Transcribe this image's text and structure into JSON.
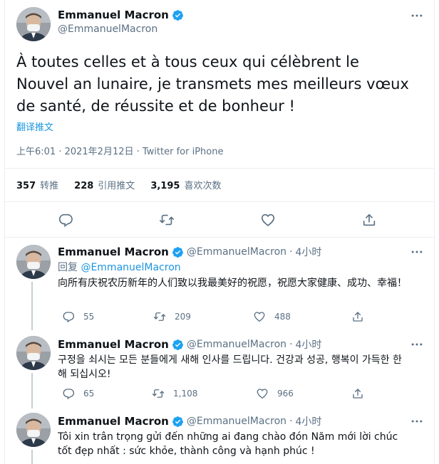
{
  "colors": {
    "accent": "#1da1f2",
    "link": "#1b95e0",
    "text": "#0f1419",
    "muted": "#5b7083"
  },
  "main_tweet": {
    "name": "Emmanuel Macron",
    "handle": "@EmmanuelMacron",
    "text": "À toutes celles et à tous ceux qui célèbrent le Nouvel an lunaire, je transmets mes meilleurs vœux de santé, de réussite et de bonheur !",
    "translate": "翻译推文",
    "meta": "上午6:01 · 2021年2月12日 · Twitter for iPhone",
    "stats": {
      "retweets_count": "357",
      "retweets_label": "转推",
      "quotes_count": "228",
      "quotes_label": "引用推文",
      "likes_count": "3,195",
      "likes_label": "喜欢次数"
    },
    "icons": [
      "reply-icon",
      "retweet-icon",
      "like-icon",
      "share-icon",
      "more-icon",
      "verified-icon"
    ]
  },
  "replies": [
    {
      "name": "Emmanuel Macron",
      "handle": "@EmmanuelMacron",
      "time": "4小时",
      "reply_to_prefix": "回复",
      "reply_to_handle": "@EmmanuelMacron",
      "text": "向所有庆祝农历新年的人们致以我最美好的祝愿，祝愿大家健康、成功、幸福！",
      "reply_count": "55",
      "retweet_count": "209",
      "like_count": "488"
    },
    {
      "name": "Emmanuel Macron",
      "handle": "@EmmanuelMacron",
      "time": "4小时",
      "text": "구정을 쇠시는 모든 분들에게 새해 인사를 드립니다. 건강과 성공, 행복이 가득한 한 해 되십시오!",
      "reply_count": "65",
      "retweet_count": "1,108",
      "like_count": "966"
    },
    {
      "name": "Emmanuel Macron",
      "handle": "@EmmanuelMacron",
      "time": "4小时",
      "text": "Tôi xin trân trọng gửi đến những ai đang chào đón Năm mới lời chúc tốt đẹp nhất : sức khỏe, thành công và hạnh phúc !"
    }
  ]
}
